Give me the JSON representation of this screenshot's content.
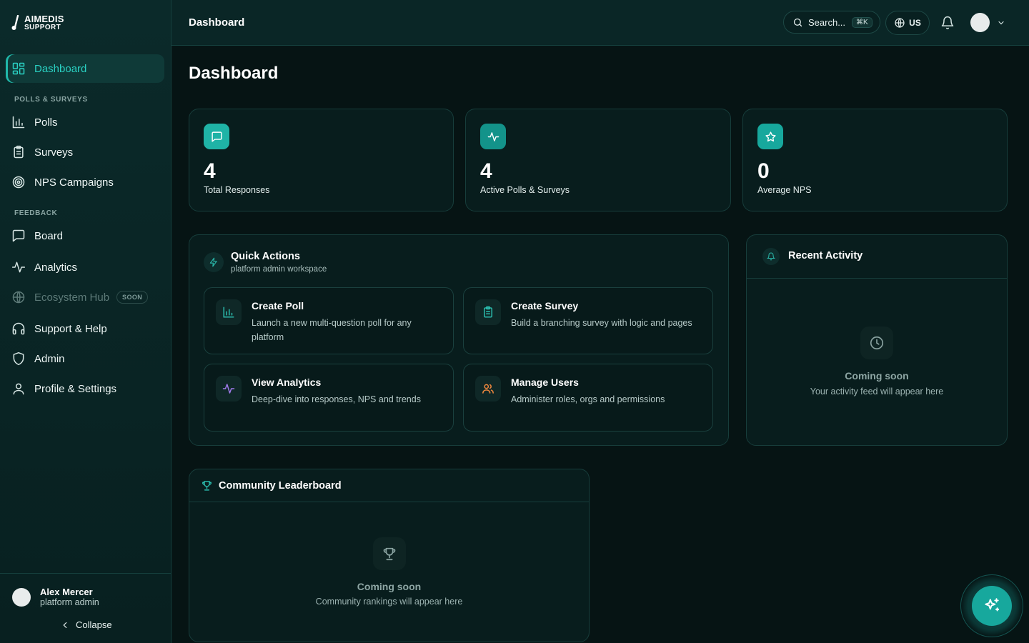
{
  "brand": {
    "line1": "AIMEDIS",
    "line2": "SUPPORT"
  },
  "sidebar": {
    "dashboard": "Dashboard",
    "section_polls": "POLLS & SURVEYS",
    "polls": "Polls",
    "surveys": "Surveys",
    "nps": "NPS Campaigns",
    "section_feedback": "FEEDBACK",
    "board": "Board",
    "analytics": "Analytics",
    "ecosystem": "Ecosystem Hub",
    "ecosystem_badge": "SOON",
    "support": "Support & Help",
    "admin": "Admin",
    "profile": "Profile & Settings"
  },
  "user": {
    "name": "Alex Mercer",
    "role": "platform admin"
  },
  "collapse_label": "Collapse",
  "topbar": {
    "title": "Dashboard",
    "search_label": "Search...",
    "search_shortcut": "⌘K",
    "lang": "US"
  },
  "page_title": "Dashboard",
  "stats": [
    {
      "value": "4",
      "label": "Total Responses",
      "color": "#1fb3a6",
      "icon": "message-square-icon"
    },
    {
      "value": "4",
      "label": "Active Polls & Surveys",
      "color": "#13938a",
      "icon": "activity-icon"
    },
    {
      "value": "0",
      "label": "Average NPS",
      "color": "#17a89d",
      "icon": "star-icon"
    }
  ],
  "quick_actions": {
    "title": "Quick Actions",
    "subtitle": "platform admin workspace",
    "items": [
      {
        "title": "Create Poll",
        "desc": "Launch a new multi-question poll for any platform",
        "icon": "bar-chart-icon",
        "color": "#2bbcae"
      },
      {
        "title": "Create Survey",
        "desc": "Build a branching survey with logic and pages",
        "icon": "clipboard-icon",
        "color": "#2bbcae"
      },
      {
        "title": "View Analytics",
        "desc": "Deep-dive into responses, NPS and trends",
        "icon": "activity-icon",
        "color": "#9f7aea"
      },
      {
        "title": "Manage Users",
        "desc": "Administer roles, orgs and permissions",
        "icon": "users-icon",
        "color": "#f0883e"
      }
    ]
  },
  "recent_activity": {
    "title": "Recent Activity",
    "empty_title": "Coming soon",
    "empty_sub": "Your activity feed will appear here"
  },
  "leaderboard": {
    "title": "Community Leaderboard",
    "empty_title": "Coming soon",
    "empty_sub": "Community rankings will appear here"
  }
}
